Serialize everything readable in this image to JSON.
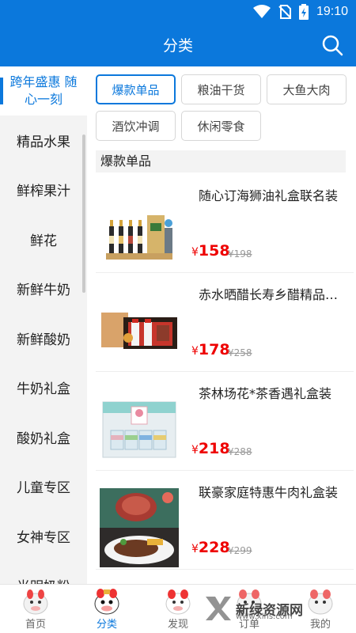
{
  "status": {
    "time": "19:10",
    "icons": [
      "wifi-icon",
      "no-sim-icon",
      "battery-icon"
    ]
  },
  "header": {
    "title": "分类",
    "search_icon": "search-icon"
  },
  "sidebar": {
    "items": [
      {
        "label": "跨年盛惠 随心一刻"
      },
      {
        "label": "精品水果"
      },
      {
        "label": "鲜榨果汁"
      },
      {
        "label": "鲜花"
      },
      {
        "label": "新鲜牛奶"
      },
      {
        "label": "新鲜酸奶"
      },
      {
        "label": "牛奶礼盒"
      },
      {
        "label": "酸奶礼盒"
      },
      {
        "label": "儿童专区"
      },
      {
        "label": "女神专区"
      },
      {
        "label": "光明奶粉"
      }
    ]
  },
  "chips": [
    {
      "label": "爆款单品"
    },
    {
      "label": "粮油干货"
    },
    {
      "label": "大鱼大肉"
    },
    {
      "label": "酒饮冲调"
    },
    {
      "label": "休闲零食"
    }
  ],
  "section": {
    "title": "爆款单品"
  },
  "products": [
    {
      "name": "随心订海狮油礼盒联名装",
      "currency": "¥",
      "price": "158",
      "old_price": "¥198"
    },
    {
      "name": "赤水晒醋长寿乡醋精品礼盒",
      "currency": "¥",
      "price": "178",
      "old_price": "¥258"
    },
    {
      "name": "茶林场花*茶香遇礼盒装",
      "currency": "¥",
      "price": "218",
      "old_price": "¥288"
    },
    {
      "name": "联豪家庭特惠牛肉礼盒装",
      "currency": "¥",
      "price": "228",
      "old_price": "¥299"
    }
  ],
  "tabbar": {
    "items": [
      {
        "label": "首页"
      },
      {
        "label": "分类"
      },
      {
        "label": "发现"
      },
      {
        "label": "订单"
      },
      {
        "label": "我的"
      }
    ]
  },
  "watermark": {
    "text": "新绿资源网",
    "sub": "www.xlhs.com"
  },
  "colors": {
    "primary": "#0b78dc",
    "price": "#ee0000"
  }
}
